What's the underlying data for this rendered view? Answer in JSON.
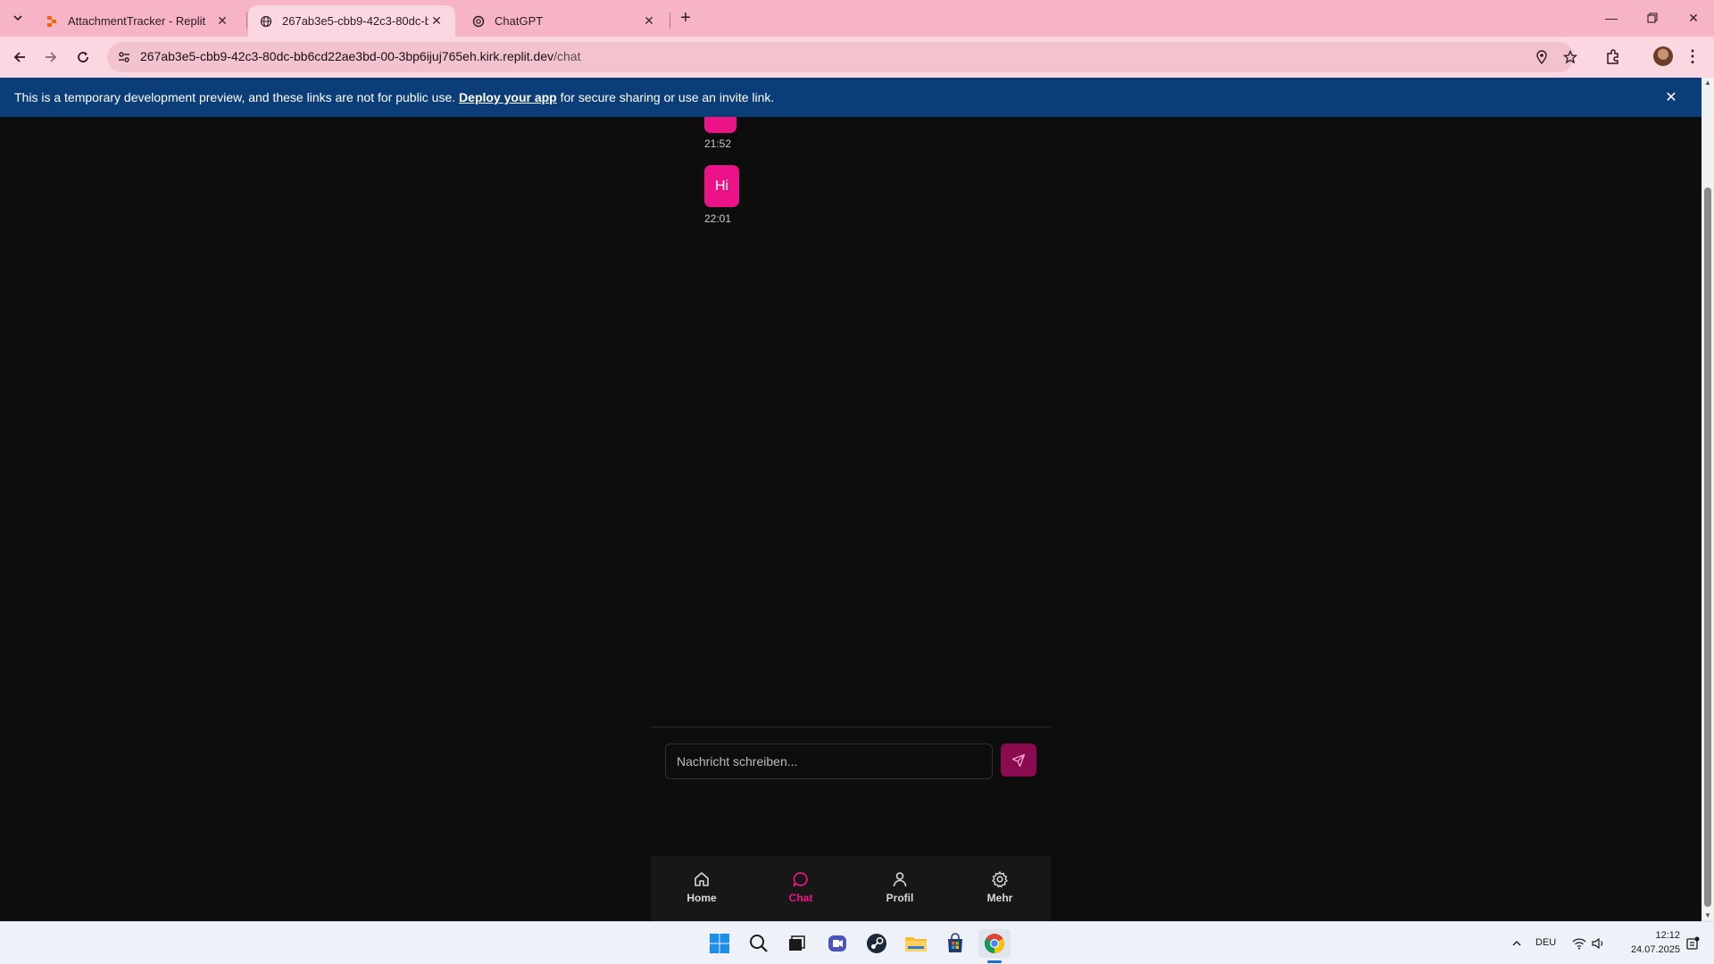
{
  "browser": {
    "tabs": [
      {
        "title": "AttachmentTracker - Replit",
        "active": false
      },
      {
        "title": "267ab3e5-cbb9-42c3-80dc-bb",
        "active": true
      },
      {
        "title": "ChatGPT",
        "active": false
      }
    ],
    "url_host": "267ab3e5-cbb9-42c3-80dc-bb6cd22ae3bd-00-3bp6ijuj765eh.kirk.replit.dev",
    "url_path": "/chat"
  },
  "banner": {
    "text_before": "This is a temporary development preview, and these links are not for public use. ",
    "link": "Deploy your app",
    "text_after": " for secure sharing or use an invite link."
  },
  "messages": [
    {
      "text": "",
      "time": "21:52"
    },
    {
      "text": "Hi",
      "time": "22:01"
    }
  ],
  "composer": {
    "placeholder": "Nachricht schreiben..."
  },
  "bottom_nav": {
    "items": [
      {
        "label": "Home",
        "icon": "home-icon",
        "active": false
      },
      {
        "label": "Chat",
        "icon": "chat-icon",
        "active": true
      },
      {
        "label": "Profil",
        "icon": "user-icon",
        "active": false
      },
      {
        "label": "Mehr",
        "icon": "gear-icon",
        "active": false
      }
    ]
  },
  "colors": {
    "accent": "#ec1389",
    "send_button": "#8a0b4f",
    "banner": "#0b3e78",
    "tabstrip": "#f8b4c7",
    "background": "#0d0d0d"
  },
  "taskbar": {
    "language": "DEU",
    "time": "12:12",
    "date": "24.07.2025"
  }
}
